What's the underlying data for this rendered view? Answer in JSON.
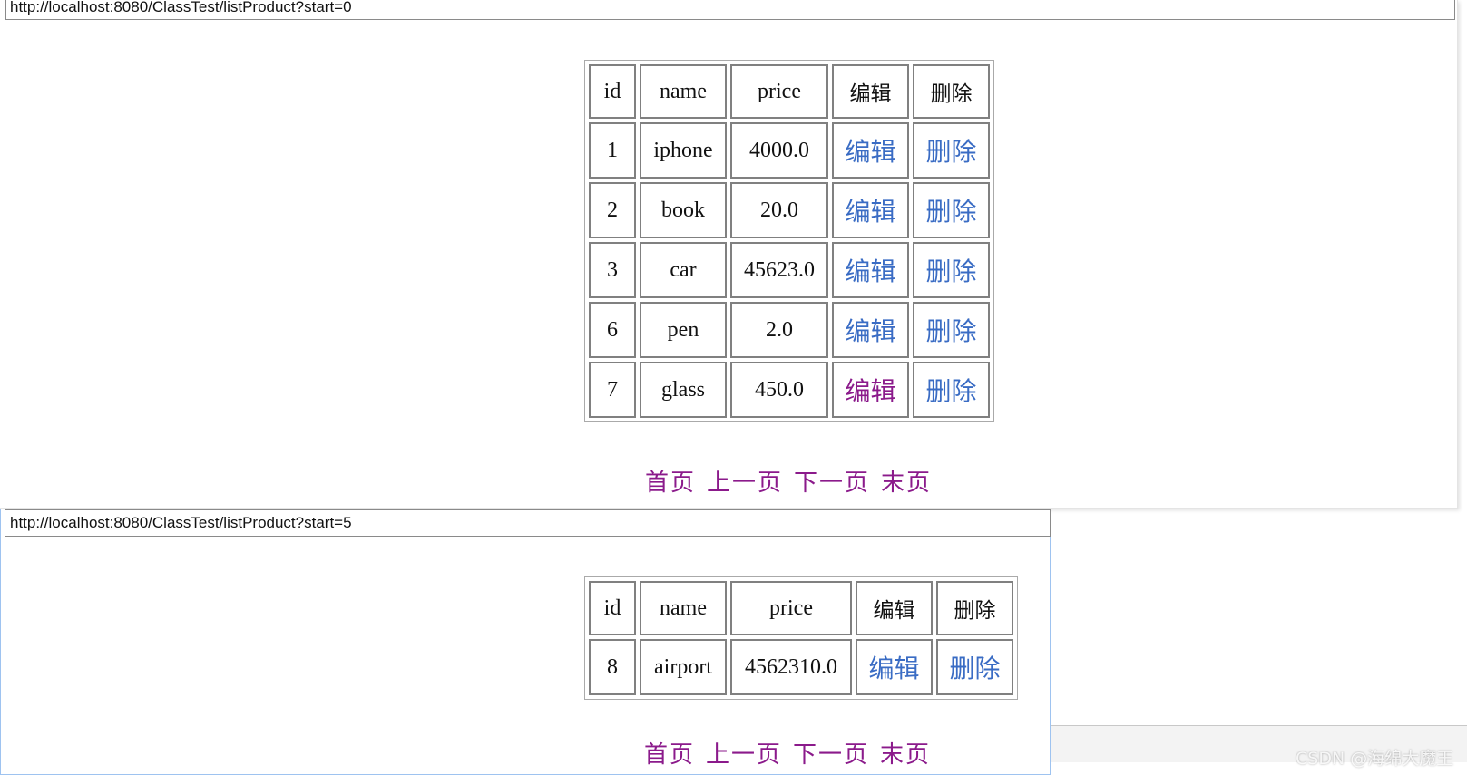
{
  "window1": {
    "url": "http://localhost:8080/ClassTest/listProduct?start=0",
    "table": {
      "headers": [
        "id",
        "name",
        "price",
        "编辑",
        "删除"
      ],
      "rows": [
        {
          "id": "1",
          "name": "iphone",
          "price": "4000.0",
          "edit": "编辑",
          "delete": "删除"
        },
        {
          "id": "2",
          "name": "book",
          "price": "20.0",
          "edit": "编辑",
          "delete": "删除"
        },
        {
          "id": "3",
          "name": "car",
          "price": "45623.0",
          "edit": "编辑",
          "delete": "删除"
        },
        {
          "id": "6",
          "name": "pen",
          "price": "2.0",
          "edit": "编辑",
          "delete": "删除"
        },
        {
          "id": "7",
          "name": "glass",
          "price": "450.0",
          "edit": "编辑",
          "delete": "删除"
        }
      ]
    },
    "pager": {
      "first": "首页",
      "prev": "上一页",
      "next": "下一页",
      "last": "末页"
    }
  },
  "window2": {
    "url": "http://localhost:8080/ClassTest/listProduct?start=5",
    "table": {
      "headers": [
        "id",
        "name",
        "price",
        "编辑",
        "删除"
      ],
      "rows": [
        {
          "id": "8",
          "name": "airport",
          "price": "4562310.0",
          "edit": "编辑",
          "delete": "删除"
        }
      ]
    },
    "pager": {
      "first": "首页",
      "prev": "上一页",
      "next": "下一页",
      "last": "末页"
    }
  },
  "watermark": "CSDN @海绵大魔王",
  "colors": {
    "link": "#3a6cc4",
    "visited_link": "#8b1a8b",
    "cell_border": "#808080"
  }
}
